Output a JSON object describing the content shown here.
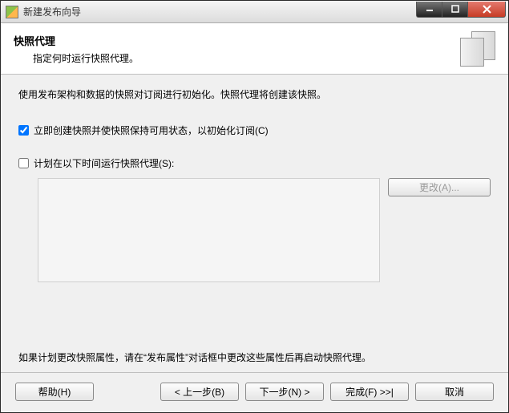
{
  "window": {
    "title": "新建发布向导"
  },
  "header": {
    "title": "快照代理",
    "subtitle": "指定何时运行快照代理。"
  },
  "content": {
    "intro": "使用发布架构和数据的快照对订阅进行初始化。快照代理将创建该快照。",
    "check_immediate": "立即创建快照并使快照保持可用状态，以初始化订阅(C)",
    "check_schedule": "计划在以下时间运行快照代理(S):",
    "change_btn": "更改(A)...",
    "note": "如果计划更改快照属性，请在“发布属性”对话框中更改这些属性后再启动快照代理。"
  },
  "footer": {
    "help": "帮助(H)",
    "back": "< 上一步(B)",
    "next": "下一步(N) >",
    "finish": "完成(F) >>|",
    "cancel": "取消"
  }
}
